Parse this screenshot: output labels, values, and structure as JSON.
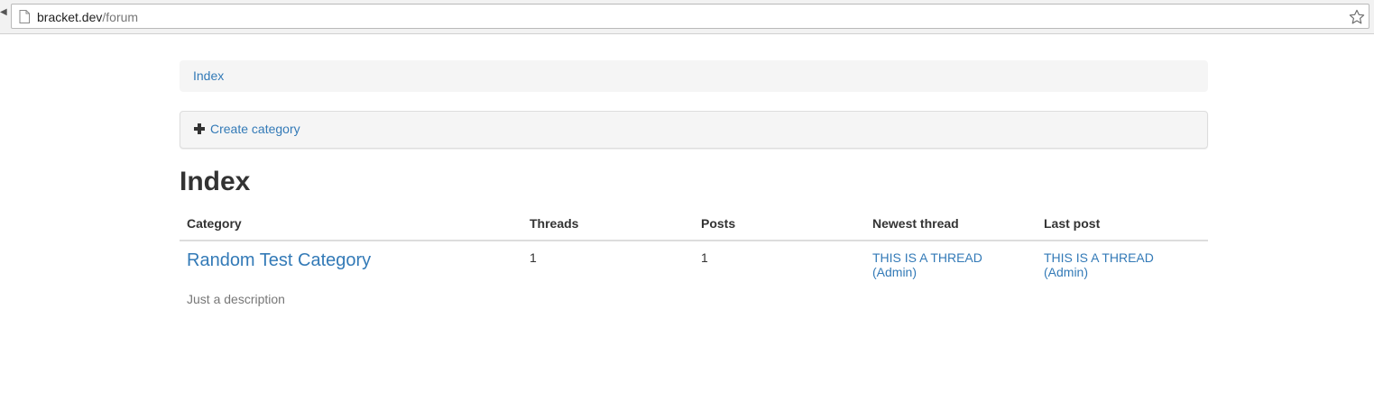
{
  "browser": {
    "url_host": "bracket.dev",
    "url_path": "/forum"
  },
  "breadcrumb": {
    "items": [
      "Index"
    ]
  },
  "actions": {
    "create_category_label": "Create category"
  },
  "page": {
    "title": "Index"
  },
  "table": {
    "headers": [
      "Category",
      "Threads",
      "Posts",
      "Newest thread",
      "Last post"
    ],
    "rows": [
      {
        "category": "Random Test Category",
        "description": "Just a description",
        "threads": "1",
        "posts": "1",
        "newest_thread": "THIS IS A THREAD (Admin)",
        "last_post": "THIS IS A THREAD (Admin)"
      }
    ]
  },
  "colors": {
    "link": "#337ab7",
    "text": "#333333",
    "muted": "#777777",
    "well": "#f5f5f5"
  }
}
